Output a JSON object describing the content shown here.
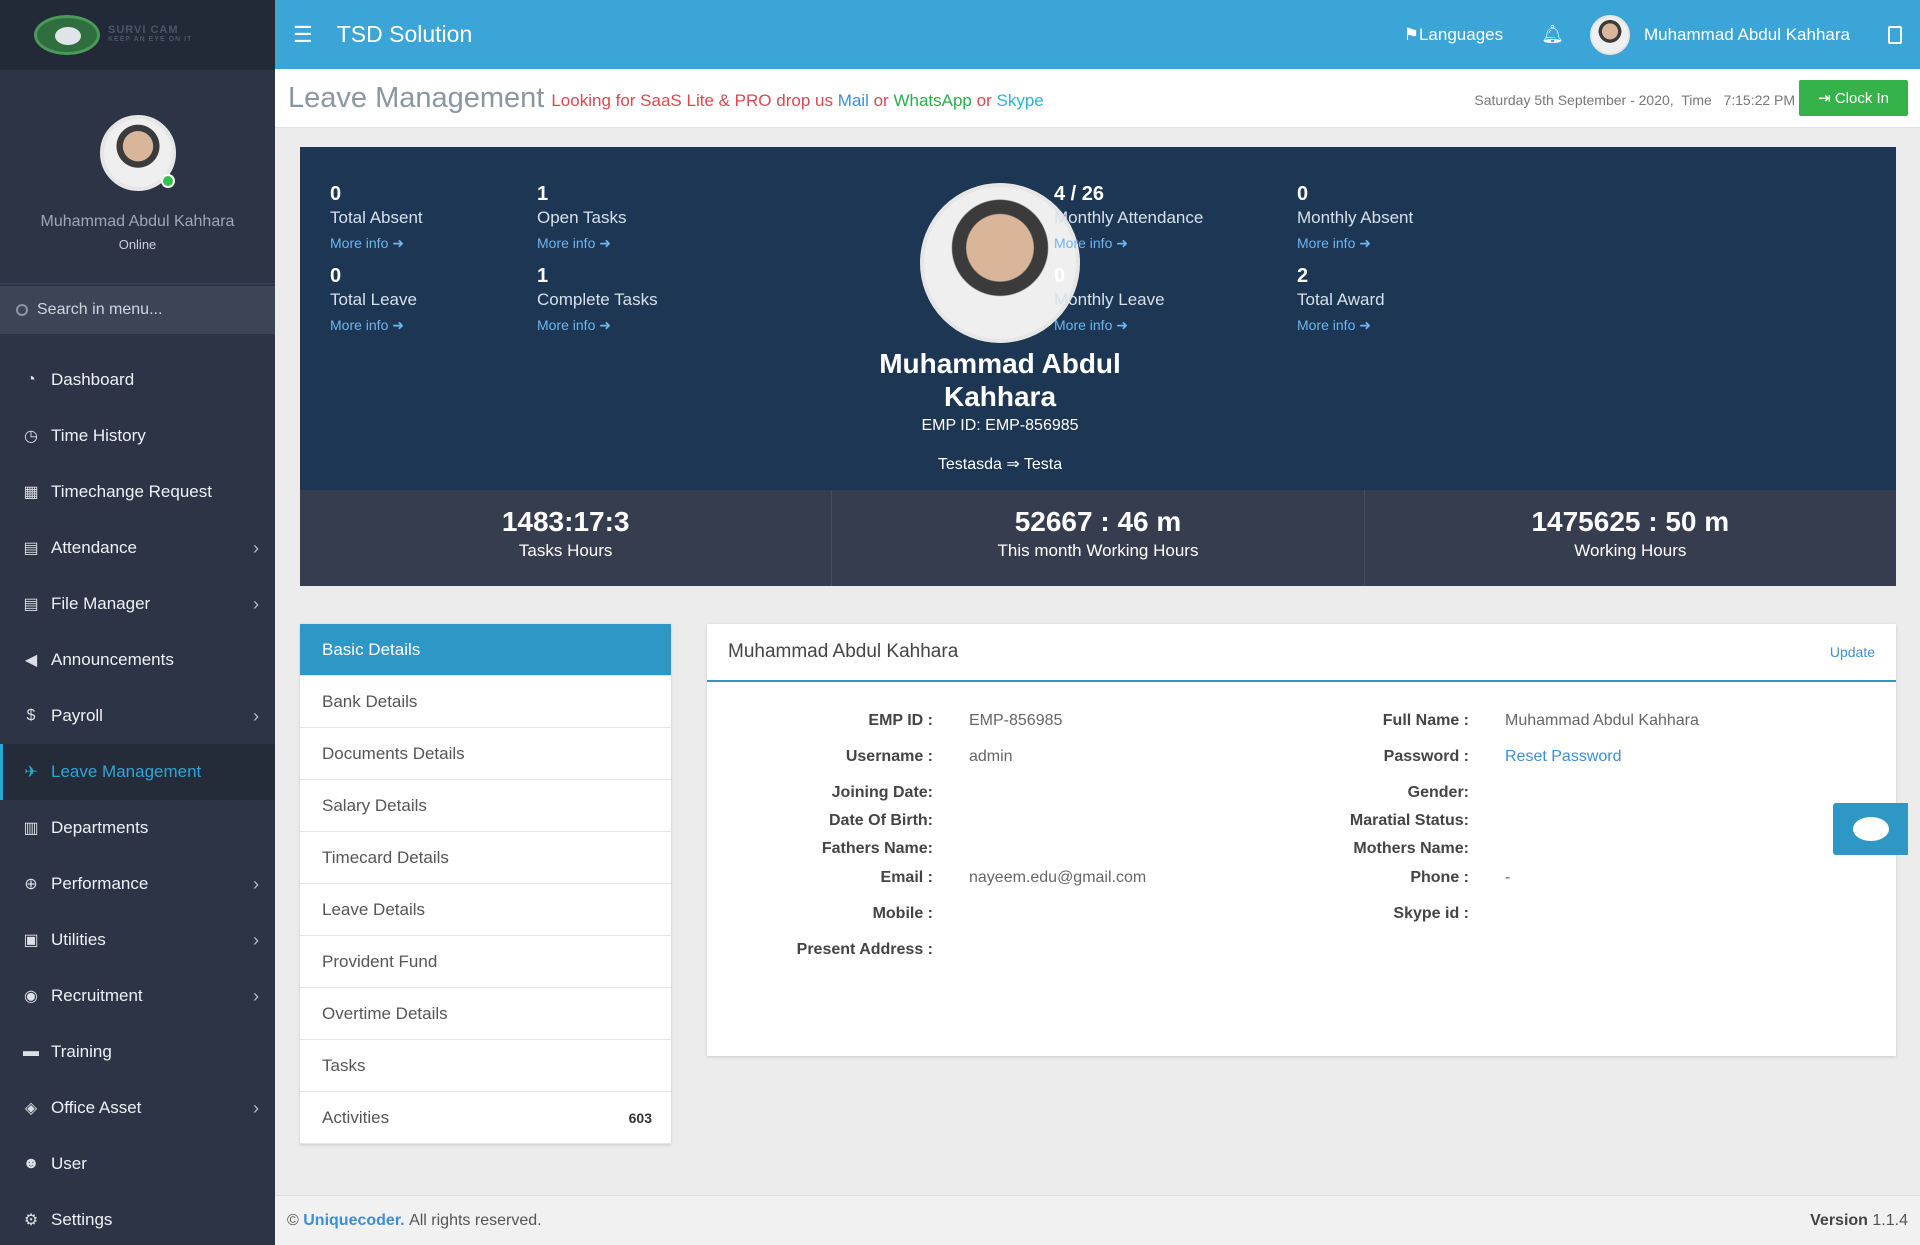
{
  "sidebar": {
    "logo_text": "SURVI CAM",
    "logo_subtext": "KEEP AN EYE ON IT",
    "user_name": "Muhammad Abdul Kahhara",
    "user_status": "Online",
    "search_placeholder": "Search in menu...",
    "items": [
      {
        "label": "Dashboard",
        "icon": "dashboard-icon",
        "glyph": "◔",
        "has_children": false
      },
      {
        "label": "Time History",
        "icon": "clock-icon",
        "glyph": "◷",
        "has_children": false
      },
      {
        "label": "Timechange Request",
        "icon": "calendar-icon",
        "glyph": "▦",
        "has_children": false
      },
      {
        "label": "Attendance",
        "icon": "file-icon",
        "glyph": "▤",
        "has_children": true
      },
      {
        "label": "File Manager",
        "icon": "file-icon",
        "glyph": "▤",
        "has_children": true
      },
      {
        "label": "Announcements",
        "icon": "bullhorn-icon",
        "glyph": "◀",
        "has_children": false
      },
      {
        "label": "Payroll",
        "icon": "dollar-icon",
        "glyph": "$",
        "has_children": true
      },
      {
        "label": "Leave Management",
        "icon": "plane-icon",
        "glyph": "✈",
        "has_children": false,
        "active": true
      },
      {
        "label": "Departments",
        "icon": "building-icon",
        "glyph": "▥",
        "has_children": false
      },
      {
        "label": "Performance",
        "icon": "globe-icon",
        "glyph": "⊕",
        "has_children": true
      },
      {
        "label": "Utilities",
        "icon": "gift-icon",
        "glyph": "▣",
        "has_children": true
      },
      {
        "label": "Recruitment",
        "icon": "globe-icon",
        "glyph": "◉",
        "has_children": true
      },
      {
        "label": "Training",
        "icon": "briefcase-icon",
        "glyph": "▬",
        "has_children": false
      },
      {
        "label": "Office Asset",
        "icon": "codepen-icon",
        "glyph": "◈",
        "has_children": true
      },
      {
        "label": "User",
        "icon": "users-icon",
        "glyph": "☻",
        "has_children": false
      },
      {
        "label": "Settings",
        "icon": "gears-icon",
        "glyph": "⚙",
        "has_children": false
      }
    ]
  },
  "topbar": {
    "app_title": "TSD Solution",
    "languages_label": "Languages",
    "user_name": "Muhammad Abdul Kahhara"
  },
  "header": {
    "page_title": "Leave Management",
    "promo_prefix": "Looking for SaaS Lite & PRO drop us",
    "promo_mail": "Mail",
    "promo_or1": "or",
    "promo_whatsapp": "WhatsApp",
    "promo_or2": "or",
    "promo_skype": "Skype",
    "date_text": "Saturday 5th September - 2020,",
    "time_label": "Time",
    "time_value": "7:15:22 PM",
    "clock_in_label": "Clock In"
  },
  "stats": {
    "more_info": "More info",
    "left": [
      {
        "value": "0",
        "label": "Total Absent"
      },
      {
        "value": "1",
        "label": "Open Tasks"
      },
      {
        "value": "0",
        "label": "Total Leave"
      },
      {
        "value": "1",
        "label": "Complete Tasks"
      }
    ],
    "right": [
      {
        "value": "4 / 26",
        "label": "Monthly Attendance"
      },
      {
        "value": "0",
        "label": "Monthly Absent"
      },
      {
        "value": "0",
        "label": "Monthly Leave"
      },
      {
        "value": "2",
        "label": "Total Award"
      }
    ]
  },
  "profile": {
    "name": "Muhammad Abdul Kahhara",
    "emp_id": "EMP ID: EMP-856985",
    "department": "Testasda ⇒ Testa"
  },
  "hours": [
    {
      "value": "1483:17:3",
      "label": "Tasks Hours"
    },
    {
      "value": "52667 : 46 m",
      "label": "This month Working Hours"
    },
    {
      "value": "1475625 : 50 m",
      "label": "Working Hours"
    }
  ],
  "tabs": [
    {
      "label": "Basic Details",
      "active": true
    },
    {
      "label": "Bank Details"
    },
    {
      "label": "Documents Details"
    },
    {
      "label": "Salary Details"
    },
    {
      "label": "Timecard Details"
    },
    {
      "label": "Leave Details"
    },
    {
      "label": "Provident Fund"
    },
    {
      "label": "Overtime Details"
    },
    {
      "label": "Tasks"
    },
    {
      "label": "Activities",
      "count": "603"
    }
  ],
  "detail": {
    "title": "Muhammad Abdul Kahhara",
    "update_label": "Update",
    "left_fields": [
      {
        "key": "EMP ID :",
        "value": "EMP-856985"
      },
      {
        "key": "Username :",
        "value": "admin"
      },
      {
        "key": "Joining Date:",
        "value": ""
      },
      {
        "key": "Date Of Birth:",
        "value": ""
      },
      {
        "key": "Fathers Name:",
        "value": ""
      },
      {
        "key": "Email :",
        "value": "nayeem.edu@gmail.com"
      },
      {
        "key": "Mobile :",
        "value": ""
      },
      {
        "key": "Present Address :",
        "value": ""
      }
    ],
    "right_fields": [
      {
        "key": "Full Name :",
        "value": "Muhammad Abdul Kahhara"
      },
      {
        "key": "Password :",
        "value": "Reset Password"
      },
      {
        "key": "Gender:",
        "value": ""
      },
      {
        "key": "Maratial Status:",
        "value": ""
      },
      {
        "key": "Mothers Name:",
        "value": ""
      },
      {
        "key": "Phone :",
        "value": "-"
      },
      {
        "key": "Skype id :",
        "value": ""
      }
    ]
  },
  "footer": {
    "copyright_symbol": "©",
    "brand": "Uniquecoder.",
    "rights": "All rights reserved.",
    "version_label": "Version",
    "version_value": "1.1.4"
  }
}
